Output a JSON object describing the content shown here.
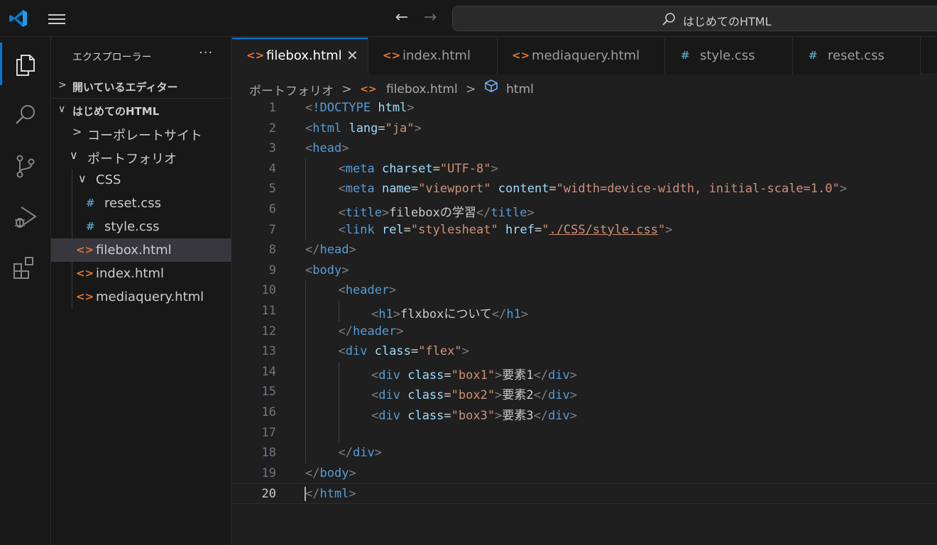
{
  "titlebar": {
    "command_center_text": "はじめてのHTML",
    "back_arrow": "←",
    "forward_arrow": "→"
  },
  "activity_bar": {
    "items": [
      "explorer-icon",
      "search-icon",
      "source-control-icon",
      "run-debug-icon",
      "extensions-icon"
    ],
    "accent": "#0078d4"
  },
  "sidebar": {
    "title": "エクスプローラー",
    "more": "···",
    "open_editors": {
      "chevron": ">",
      "label": "開いているエディター"
    },
    "workspace": {
      "chevron": "∨",
      "label": "はじめてのHTML"
    },
    "tree": [
      {
        "chevron": ">",
        "label": "コーポレートサイト",
        "type": "folder"
      },
      {
        "chevron": "∨",
        "label": "ポートフォリオ",
        "type": "folder"
      },
      {
        "chevron": "∨",
        "label": "CSS",
        "type": "folder"
      },
      {
        "icon": "#",
        "label": "reset.css",
        "type": "css"
      },
      {
        "icon": "#",
        "label": "style.css",
        "type": "css"
      },
      {
        "icon": "<>",
        "label": "filebox.html",
        "type": "html",
        "selected": true
      },
      {
        "icon": "<>",
        "label": "index.html",
        "type": "html"
      },
      {
        "icon": "<>",
        "label": "mediaquery.html",
        "type": "html"
      }
    ]
  },
  "tabs": [
    {
      "icon": "<>",
      "label": "filebox.html",
      "active": true,
      "close": "✕"
    },
    {
      "icon": "<>",
      "label": "index.html"
    },
    {
      "icon": "<>",
      "label": "mediaquery.html"
    },
    {
      "icon": "#",
      "label": "style.css"
    },
    {
      "icon": "#",
      "label": "reset.css"
    }
  ],
  "breadcrumb": {
    "folder": "ポートフォリオ",
    "file_icon": "<>",
    "file": "filebox.html",
    "symbol": "html",
    "sep": ">"
  },
  "editor": {
    "current_line": 20,
    "lines": [
      {
        "n": "1",
        "indent": 0,
        "tokens": [
          [
            "br",
            "<"
          ],
          [
            "tag",
            "!DOCTYPE"
          ],
          [
            "txt",
            " "
          ],
          [
            "attr",
            "html"
          ],
          [
            "br",
            ">"
          ]
        ]
      },
      {
        "n": "2",
        "indent": 0,
        "tokens": [
          [
            "br",
            "<"
          ],
          [
            "tag",
            "html"
          ],
          [
            "txt",
            " "
          ],
          [
            "attr",
            "lang"
          ],
          [
            "txt",
            "="
          ],
          [
            "str",
            "\"ja\""
          ],
          [
            "br",
            ">"
          ]
        ]
      },
      {
        "n": "3",
        "indent": 0,
        "tokens": [
          [
            "br",
            "<"
          ],
          [
            "tag",
            "head"
          ],
          [
            "br",
            ">"
          ]
        ]
      },
      {
        "n": "4",
        "indent": 1,
        "tokens": [
          [
            "br",
            "<"
          ],
          [
            "tag",
            "meta"
          ],
          [
            "txt",
            " "
          ],
          [
            "attr",
            "charset"
          ],
          [
            "txt",
            "="
          ],
          [
            "str",
            "\"UTF-8\""
          ],
          [
            "br",
            ">"
          ]
        ]
      },
      {
        "n": "5",
        "indent": 1,
        "tokens": [
          [
            "br",
            "<"
          ],
          [
            "tag",
            "meta"
          ],
          [
            "txt",
            " "
          ],
          [
            "attr",
            "name"
          ],
          [
            "txt",
            "="
          ],
          [
            "str",
            "\"viewport\""
          ],
          [
            "txt",
            " "
          ],
          [
            "attr",
            "content"
          ],
          [
            "txt",
            "="
          ],
          [
            "str",
            "\"width=device-width, initial-scale=1.0\""
          ],
          [
            "br",
            ">"
          ]
        ]
      },
      {
        "n": "6",
        "indent": 1,
        "tokens": [
          [
            "br",
            "<"
          ],
          [
            "tag",
            "title"
          ],
          [
            "br",
            ">"
          ],
          [
            "txt",
            "fileboxの学習"
          ],
          [
            "br",
            "</"
          ],
          [
            "tag",
            "title"
          ],
          [
            "br",
            ">"
          ]
        ]
      },
      {
        "n": "7",
        "indent": 1,
        "tokens": [
          [
            "br",
            "<"
          ],
          [
            "tag",
            "link"
          ],
          [
            "txt",
            " "
          ],
          [
            "attr",
            "rel"
          ],
          [
            "txt",
            "="
          ],
          [
            "str",
            "\"stylesheat\""
          ],
          [
            "txt",
            " "
          ],
          [
            "attr",
            "href"
          ],
          [
            "txt",
            "="
          ],
          [
            "str",
            "\""
          ],
          [
            "link",
            "./CSS/style.css"
          ],
          [
            "str",
            "\""
          ],
          [
            "br",
            ">"
          ]
        ]
      },
      {
        "n": "8",
        "indent": 0,
        "tokens": [
          [
            "br",
            "</"
          ],
          [
            "tag",
            "head"
          ],
          [
            "br",
            ">"
          ]
        ]
      },
      {
        "n": "9",
        "indent": 0,
        "tokens": [
          [
            "br",
            "<"
          ],
          [
            "tag",
            "body"
          ],
          [
            "br",
            ">"
          ]
        ]
      },
      {
        "n": "10",
        "indent": 1,
        "tokens": [
          [
            "br",
            "<"
          ],
          [
            "tag",
            "header"
          ],
          [
            "br",
            ">"
          ]
        ]
      },
      {
        "n": "11",
        "indent": 2,
        "tokens": [
          [
            "br",
            "<"
          ],
          [
            "tag",
            "h1"
          ],
          [
            "br",
            ">"
          ],
          [
            "txt",
            "flxboxについて"
          ],
          [
            "br",
            "</"
          ],
          [
            "tag",
            "h1"
          ],
          [
            "br",
            ">"
          ]
        ]
      },
      {
        "n": "12",
        "indent": 1,
        "tokens": [
          [
            "br",
            "</"
          ],
          [
            "tag",
            "header"
          ],
          [
            "br",
            ">"
          ]
        ]
      },
      {
        "n": "13",
        "indent": 1,
        "tokens": [
          [
            "br",
            "<"
          ],
          [
            "tag",
            "div"
          ],
          [
            "txt",
            " "
          ],
          [
            "attr",
            "class"
          ],
          [
            "txt",
            "="
          ],
          [
            "str",
            "\"flex\""
          ],
          [
            "br",
            ">"
          ]
        ]
      },
      {
        "n": "14",
        "indent": 2,
        "tokens": [
          [
            "br",
            "<"
          ],
          [
            "tag",
            "div"
          ],
          [
            "txt",
            " "
          ],
          [
            "attr",
            "class"
          ],
          [
            "txt",
            "="
          ],
          [
            "str",
            "\"box1\""
          ],
          [
            "br",
            ">"
          ],
          [
            "txt",
            "要素1"
          ],
          [
            "br",
            "</"
          ],
          [
            "tag",
            "div"
          ],
          [
            "br",
            ">"
          ]
        ]
      },
      {
        "n": "15",
        "indent": 2,
        "tokens": [
          [
            "br",
            "<"
          ],
          [
            "tag",
            "div"
          ],
          [
            "txt",
            " "
          ],
          [
            "attr",
            "class"
          ],
          [
            "txt",
            "="
          ],
          [
            "str",
            "\"box2\""
          ],
          [
            "br",
            ">"
          ],
          [
            "txt",
            "要素2"
          ],
          [
            "br",
            "</"
          ],
          [
            "tag",
            "div"
          ],
          [
            "br",
            ">"
          ]
        ]
      },
      {
        "n": "16",
        "indent": 2,
        "tokens": [
          [
            "br",
            "<"
          ],
          [
            "tag",
            "div"
          ],
          [
            "txt",
            " "
          ],
          [
            "attr",
            "class"
          ],
          [
            "txt",
            "="
          ],
          [
            "str",
            "\"box3\""
          ],
          [
            "br",
            ">"
          ],
          [
            "txt",
            "要素3"
          ],
          [
            "br",
            "</"
          ],
          [
            "tag",
            "div"
          ],
          [
            "br",
            ">"
          ]
        ]
      },
      {
        "n": "17",
        "indent": 2,
        "tokens": []
      },
      {
        "n": "18",
        "indent": 1,
        "tokens": [
          [
            "br",
            "</"
          ],
          [
            "tag",
            "div"
          ],
          [
            "br",
            ">"
          ]
        ]
      },
      {
        "n": "19",
        "indent": 0,
        "tokens": [
          [
            "br",
            "</"
          ],
          [
            "tag",
            "body"
          ],
          [
            "br",
            ">"
          ]
        ]
      },
      {
        "n": "20",
        "indent": 0,
        "tokens": [
          [
            "br",
            "</"
          ],
          [
            "tag",
            "html"
          ],
          [
            "br",
            ">"
          ]
        ]
      }
    ]
  },
  "colors": {
    "html_icon": "#e37933",
    "css_icon": "#519aba",
    "tag": "#569cd6",
    "attr": "#9cdcfe",
    "string": "#ce9178"
  }
}
